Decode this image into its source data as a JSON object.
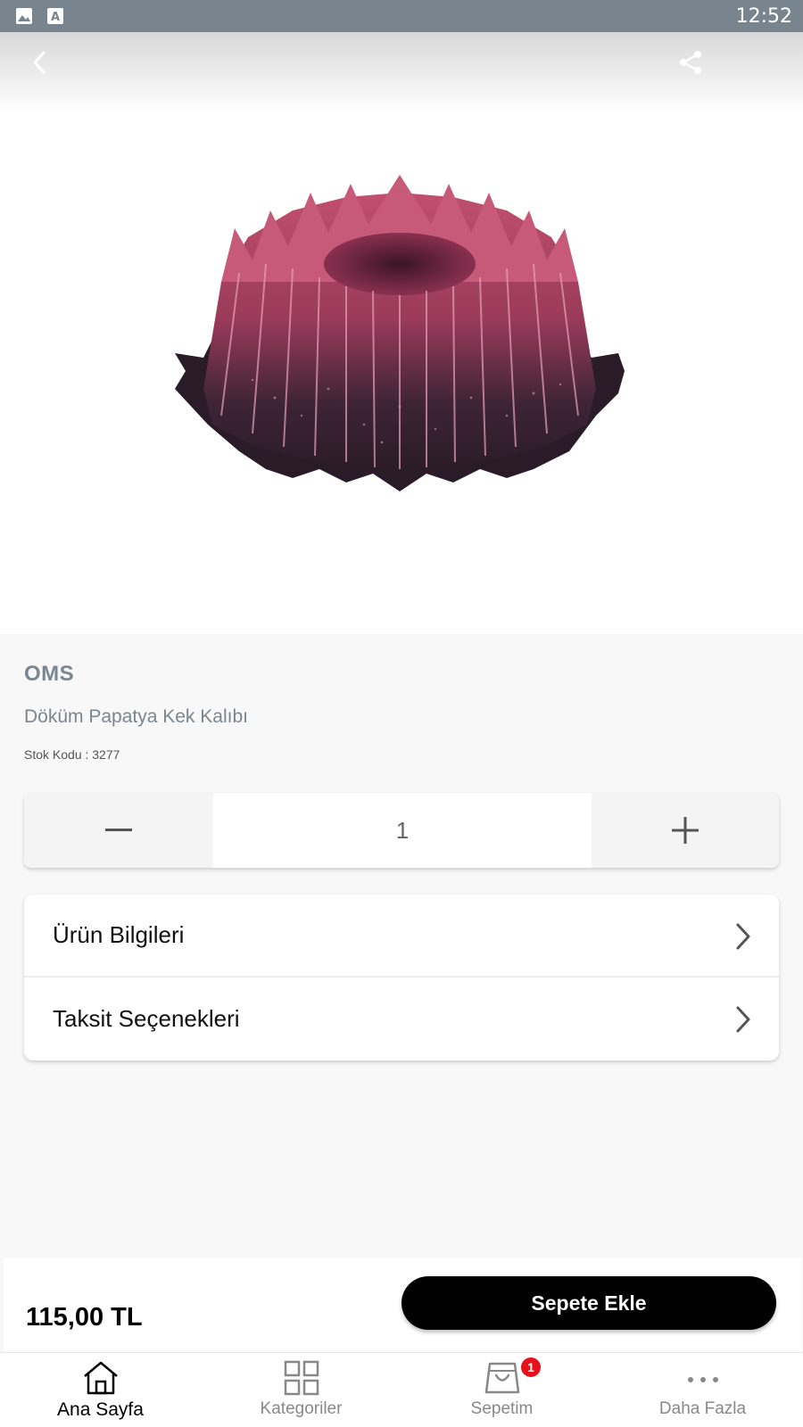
{
  "status_bar": {
    "time": "12:52"
  },
  "product": {
    "brand": "OMS",
    "name": "Döküm Papatya Kek Kalıbı",
    "sku": "Stok Kodu : 3277",
    "quantity": "1",
    "price": "115,00 TL"
  },
  "accordion": {
    "items": [
      {
        "label": "Ürün Bilgileri"
      },
      {
        "label": "Taksit Seçenekleri"
      }
    ]
  },
  "actions": {
    "add_to_cart": "Sepete Ekle"
  },
  "bottom_nav": {
    "items": [
      {
        "label": "Ana Sayfa",
        "icon": "home-icon",
        "active": true
      },
      {
        "label": "Kategoriler",
        "icon": "grid-icon",
        "active": false
      },
      {
        "label": "Sepetim",
        "icon": "shopping-bag-icon",
        "active": false,
        "badge": "1"
      },
      {
        "label": "Daha Fazla",
        "icon": "more-dots-icon",
        "active": false
      }
    ]
  },
  "colors": {
    "status_bar": "#78858e",
    "brand_text": "#7a8690",
    "badge": "#e8101a",
    "primary_button": "#000000"
  }
}
